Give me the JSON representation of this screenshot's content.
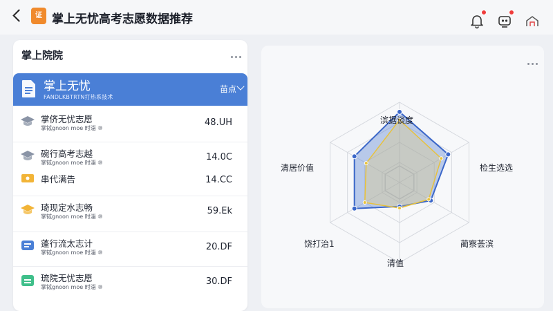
{
  "topbar": {
    "title": "掌上无忧高考志愿数据推荐",
    "logo_text": "证",
    "icons": [
      "back-icon",
      "bell-icon",
      "robot-icon",
      "network-icon"
    ]
  },
  "left_panel": {
    "title": "掌上院院",
    "header": {
      "title": "掌上无忧",
      "subtitle": "FANDLKBTRTN打热系技术",
      "filter_label": "苗点"
    },
    "items": [
      {
        "title": "掌侪无忧志愿",
        "sub": "掌铽gnoon moe 时淄 ⑩",
        "value": "48.UH",
        "icon": "graduation-cap-icon",
        "icon_color": "#8a94a6"
      },
      {
        "title": "碗行高考志越",
        "sub": "掌铽gnoon moe 时淄 ⑩",
        "value": "14.0C",
        "icon": "graduation-cap-icon",
        "icon_color": "#8a94a6"
      },
      {
        "title": "串代满告",
        "sub": "",
        "value": "14.CC",
        "icon": "ticket-icon",
        "icon_color": "#f2b437"
      },
      {
        "title": "琦现定水志畅",
        "sub": "掌铽gnoon moe 时淄 ⑩",
        "value": "59.Ek",
        "icon": "graduation-cap-icon",
        "icon_color": "#f2b437"
      },
      {
        "title": "蓬行流太志计",
        "sub": "掌铽gnoon moe 时淄 ⑩",
        "value": "20.DF",
        "icon": "chat-icon",
        "icon_color": "#4a7fd6"
      },
      {
        "title": "琉院无忧志愿",
        "sub": "掌铽gnoon moe 时淄 ⑩",
        "value": "30.DF",
        "icon": "calendar-icon",
        "icon_color": "#3fbf8a"
      }
    ]
  },
  "radar": {
    "axes": [
      "滨据谈度",
      "检生选选",
      "蔺察荟滨",
      "清值",
      "饶打治1",
      "清居价值"
    ],
    "max": 100,
    "series": [
      {
        "values": [
          88,
          70,
          45,
          30,
          65,
          65
        ],
        "color": "#3b67c9",
        "fill": "rgba(90,130,210,0.40)"
      },
      {
        "values": [
          78,
          60,
          42,
          32,
          50,
          48
        ],
        "color": "#e8c23c",
        "fill": "rgba(235,205,110,0.30)"
      }
    ],
    "colors": {
      "grid": "#d5d8de",
      "center_cube": "#c8ccd4"
    }
  },
  "colors": {
    "accent": "#4a7fd6",
    "badge": "#ef3b3b"
  }
}
